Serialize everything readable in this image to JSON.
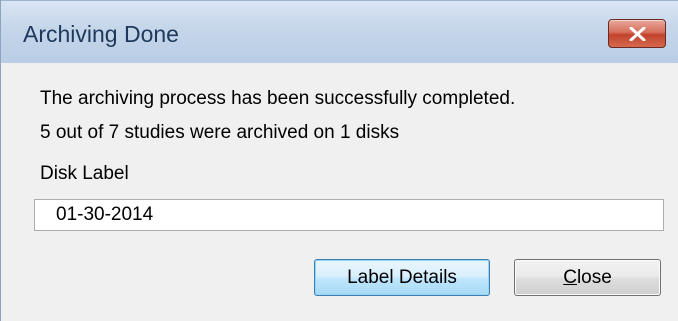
{
  "window": {
    "title": "Archiving Done"
  },
  "message": {
    "line1": "The archiving process has been successfully completed.",
    "line2": "5 out of 7 studies were archived on 1 disks"
  },
  "disk_label": {
    "label": "Disk Label",
    "value": "01-30-2014"
  },
  "buttons": {
    "label_details": "Label Details",
    "close_first": "C",
    "close_rest": "lose"
  },
  "icons": {
    "close": "close-icon"
  },
  "colors": {
    "title_bar": "#c5d6ea",
    "close_button": "#c2432c",
    "default_button_border": "#3c7fb1",
    "dialog_background": "#f0f0f0"
  }
}
